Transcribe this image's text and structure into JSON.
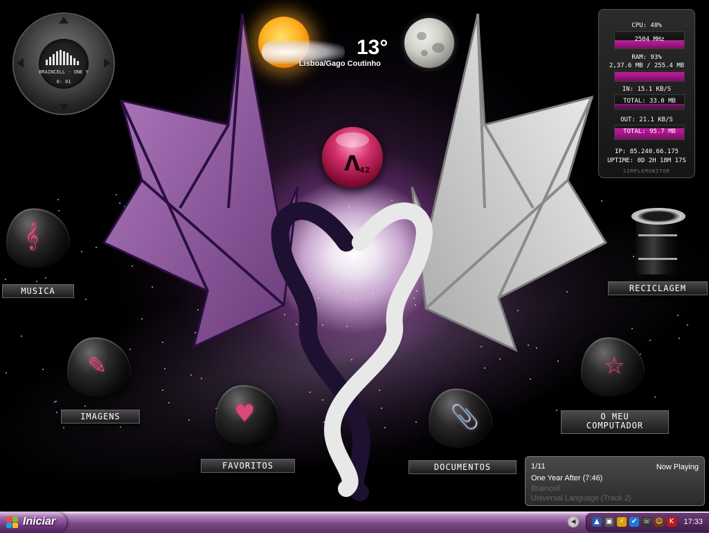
{
  "player": {
    "track": "BRAINCELL - ONE Y",
    "time": "0: 01"
  },
  "weather": {
    "temperature": "13°",
    "location": "Lisboa/Gago Coutinho"
  },
  "orb": {
    "number": "42"
  },
  "monitor": {
    "cpu_label": "CPU: 48%",
    "cpu_freq": "2504 MHz",
    "cpu_level": 0.48,
    "ram_label": "RAM: 93%",
    "ram_detail": "2,37.6 MB / 255.4 MB",
    "ram_level": 0.93,
    "in_label": "IN: 15.1 KB/S",
    "in_total": "TOTAL: 33.0 MB",
    "out_label": "OUT: 21.1 KB/S",
    "out_total": "TOTAL: 95.7 MB",
    "ip": "IP: 85.240.66.175",
    "uptime": "UPTIME: 0D 2H 18M 17S",
    "brand": "SIMPLEMONITOR"
  },
  "desktop_icons": {
    "musica": "MUSICA",
    "imagens": "IMAGENS",
    "favoritos": "FAVORITOS",
    "documentos": "DOCUMENTOS",
    "o_meu_computador_1": "O MEU",
    "o_meu_computador_2": "COMPUTADOR",
    "reciclagem": "RECICLAGEM"
  },
  "now_playing": {
    "counter": "1/11",
    "header": "Now Playing",
    "title": "One Year After (7:46)",
    "artist": "Braincell",
    "album": "Universal Language (Track 2)"
  },
  "taskbar": {
    "start_label": "Iniciar",
    "clock": "17:33"
  },
  "colors": {
    "accent": "#c21fa0",
    "taskbar": "#7a4a86",
    "icon_glyph": "#d84a7a"
  }
}
